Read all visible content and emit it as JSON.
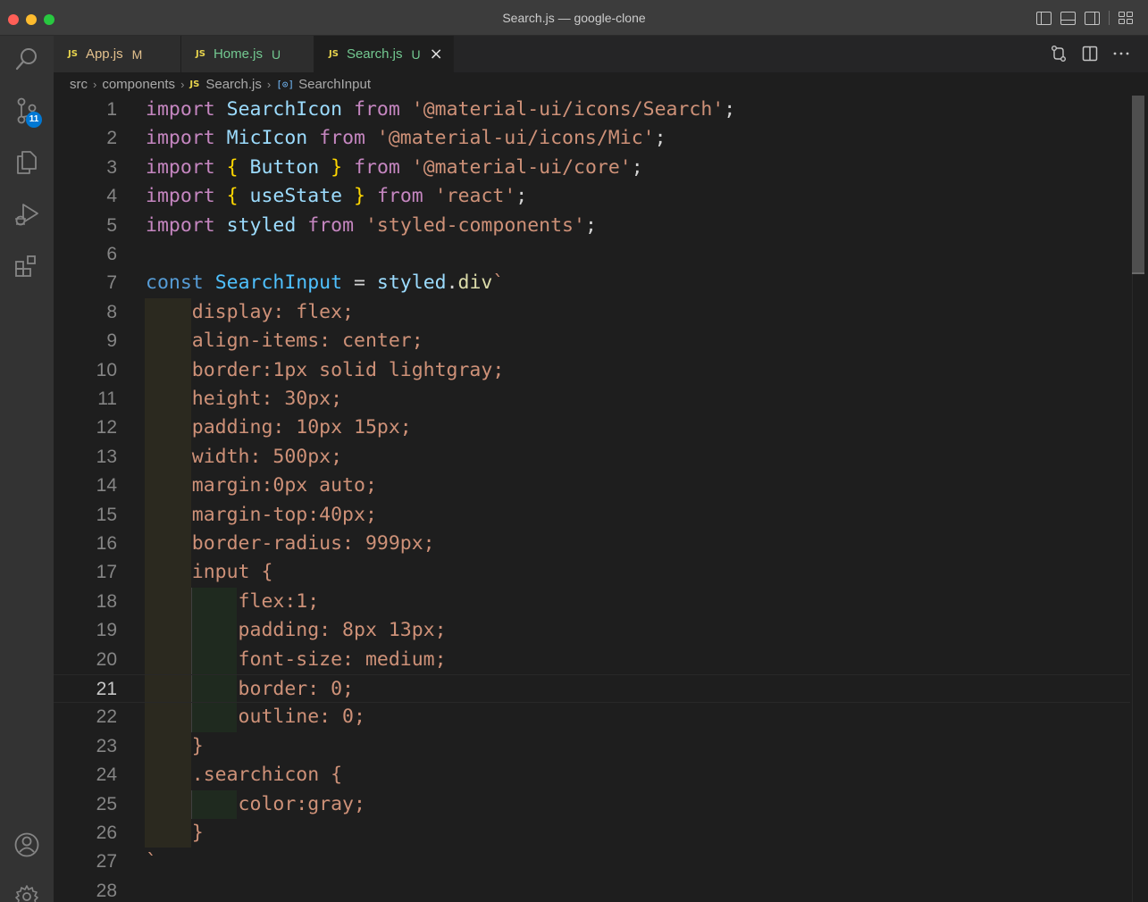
{
  "window": {
    "title": "Search.js — google-clone"
  },
  "activity_bar": {
    "source_control_badge": "11"
  },
  "tabs": [
    {
      "label": "App.js",
      "status": "M"
    },
    {
      "label": "Home.js",
      "status": "U"
    },
    {
      "label": "Search.js",
      "status": "U",
      "close": "×"
    }
  ],
  "breadcrumb": {
    "src": "src",
    "components": "components",
    "file_tag": "JS",
    "file": "Search.js",
    "symbol_icon": "[⊙]",
    "symbol": "SearchInput",
    "separator": "›"
  },
  "js_tag": "JS",
  "editor": {
    "current_line": 21,
    "lines": [
      {
        "n": "1",
        "t": [
          "import",
          " ",
          "SearchIcon",
          " ",
          "from",
          " ",
          "'@material-ui/icons/Search'",
          ";"
        ]
      },
      {
        "n": "2",
        "t": [
          "import",
          " ",
          "MicIcon",
          " ",
          "from",
          " ",
          "'@material-ui/icons/Mic'",
          ";"
        ]
      },
      {
        "n": "3",
        "t": [
          "import",
          " ",
          "{",
          " ",
          "Button",
          " ",
          "}",
          " ",
          "from",
          " ",
          "'@material-ui/core'",
          ";"
        ]
      },
      {
        "n": "4",
        "t": [
          "import",
          " ",
          "{",
          " ",
          "useState",
          " ",
          "}",
          " ",
          "from",
          " ",
          "'react'",
          ";"
        ]
      },
      {
        "n": "5",
        "t": [
          "import",
          " ",
          "styled",
          " ",
          "from",
          " ",
          "'styled-components'",
          ";"
        ]
      },
      {
        "n": "6",
        "t": []
      },
      {
        "n": "7",
        "t": [
          "const",
          " ",
          "SearchInput",
          " = ",
          "styled",
          ".",
          "div",
          "`"
        ]
      },
      {
        "n": "8",
        "t": [
          "    display: flex;"
        ]
      },
      {
        "n": "9",
        "t": [
          "    align-items: center;"
        ]
      },
      {
        "n": "10",
        "t": [
          "    border:1px solid lightgray;"
        ]
      },
      {
        "n": "11",
        "t": [
          "    height: 30px;"
        ]
      },
      {
        "n": "12",
        "t": [
          "    padding: 10px 15px;"
        ]
      },
      {
        "n": "13",
        "t": [
          "    width: 500px;"
        ]
      },
      {
        "n": "14",
        "t": [
          "    margin:0px auto;"
        ]
      },
      {
        "n": "15",
        "t": [
          "    margin-top:40px;"
        ]
      },
      {
        "n": "16",
        "t": [
          "    border-radius: 999px;"
        ]
      },
      {
        "n": "17",
        "t": [
          "    input {"
        ]
      },
      {
        "n": "18",
        "t": [
          "        flex:1;"
        ]
      },
      {
        "n": "19",
        "t": [
          "        padding: 8px 13px;"
        ]
      },
      {
        "n": "20",
        "t": [
          "        font-size: medium;"
        ]
      },
      {
        "n": "21",
        "t": [
          "        border: 0;"
        ]
      },
      {
        "n": "22",
        "t": [
          "        outline: 0;"
        ]
      },
      {
        "n": "23",
        "t": [
          "    }"
        ]
      },
      {
        "n": "24",
        "t": [
          "    .searchicon {"
        ]
      },
      {
        "n": "25",
        "t": [
          "        color:gray;"
        ]
      },
      {
        "n": "26",
        "t": [
          "    }"
        ]
      },
      {
        "n": "27",
        "t": [
          "`"
        ]
      },
      {
        "n": "28",
        "t": []
      }
    ]
  }
}
